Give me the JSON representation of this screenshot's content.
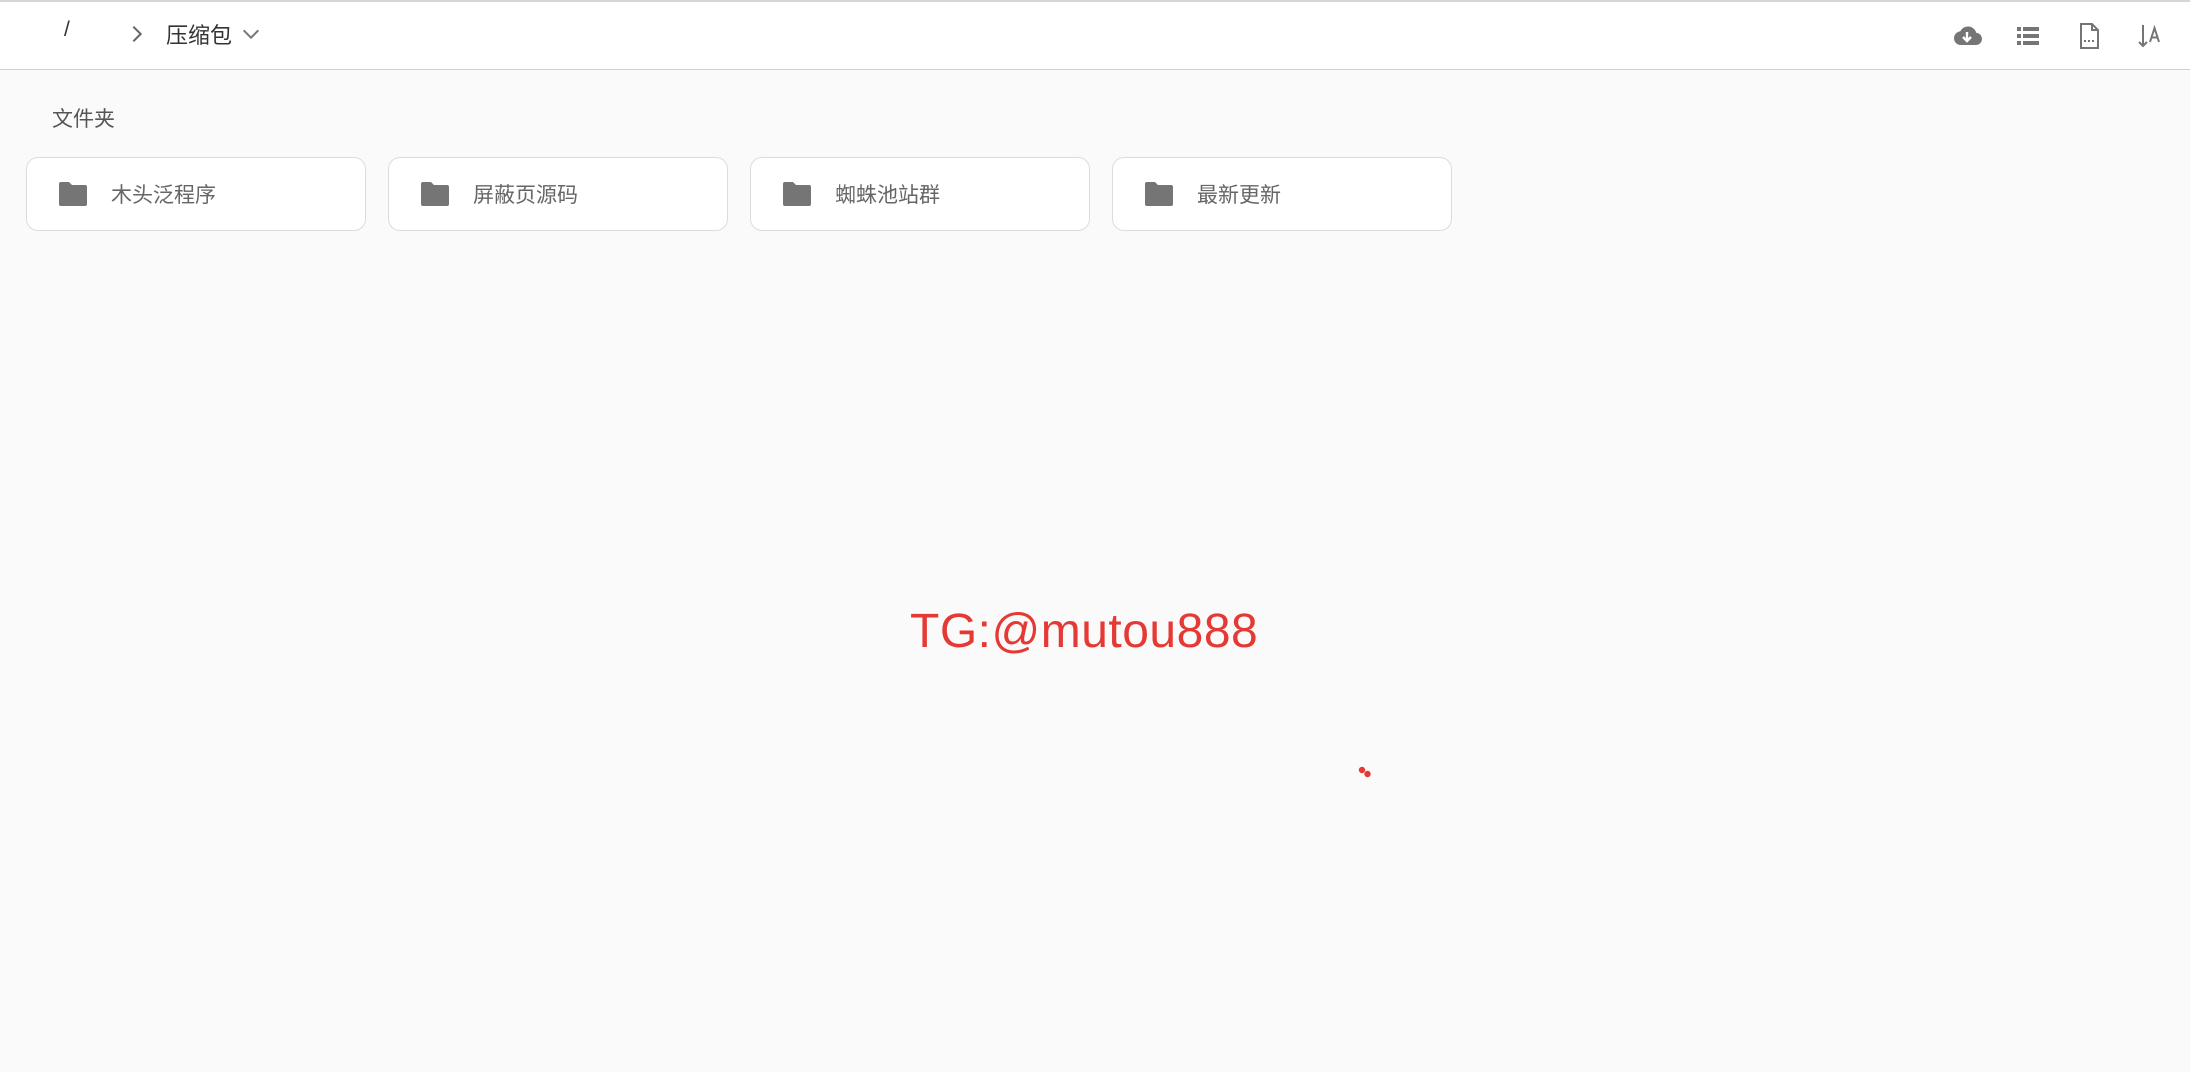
{
  "header": {
    "breadcrumb_root": "/",
    "current_folder": "压缩包",
    "separator_icon": "chevron-right-icon",
    "dropdown_icon": "chevron-down-icon",
    "tools": [
      {
        "name": "download-icon"
      },
      {
        "name": "list-view-icon"
      },
      {
        "name": "file-preview-icon"
      },
      {
        "name": "sort-icon"
      }
    ]
  },
  "section": {
    "title": "文件夹"
  },
  "folders": [
    {
      "label": "木头泛程序"
    },
    {
      "label": "屏蔽页源码"
    },
    {
      "label": "蜘蛛池站群"
    },
    {
      "label": "最新更新"
    }
  ],
  "watermark": {
    "text": "TG:@mutou888"
  },
  "colors": {
    "accent": "#e53935",
    "icon": "#757575",
    "background": "#fafafa"
  }
}
